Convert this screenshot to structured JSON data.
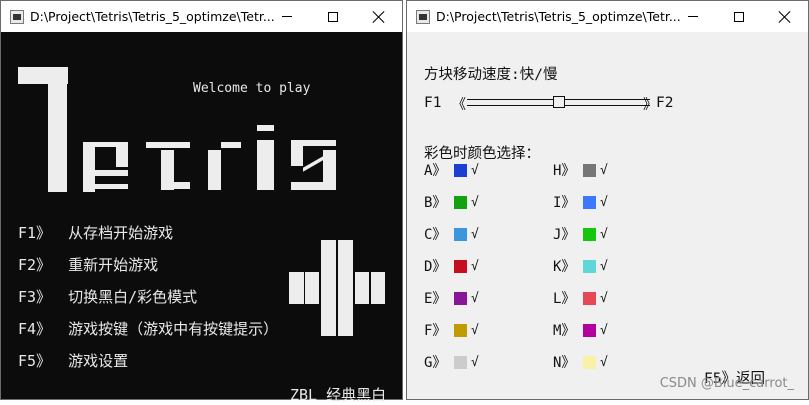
{
  "left_window": {
    "title": "D:\\Project\\Tetris\\Tetris_5_optimze\\Tetr...",
    "welcome": "Welcome to play",
    "menu": [
      {
        "key": "F1》",
        "text": "从存档开始游戏"
      },
      {
        "key": "F2》",
        "text": "重新开始游戏"
      },
      {
        "key": "F3》",
        "text": "切换黑白/彩色模式"
      },
      {
        "key": "F4》",
        "text": "游戏按键（游戏中有按键提示）"
      },
      {
        "key": "F5》",
        "text": "游戏设置"
      }
    ],
    "footer": "ZBL  经典黑白"
  },
  "right_window": {
    "title": "D:\\Project\\Tetris\\Tetris_5_optimze\\Tetr...",
    "speed_label": "方块移动速度:快/慢",
    "slider": {
      "left_label": "F1",
      "left_arrow": "《",
      "right_arrow": "》",
      "right_label": "F2",
      "position": 0.5
    },
    "color_label": "彩色时颜色选择：",
    "check_mark": "√",
    "colors_left": [
      {
        "label": "A》",
        "color": "#1a3fd1"
      },
      {
        "label": "B》",
        "color": "#13a10e"
      },
      {
        "label": "C》",
        "color": "#3a96dd"
      },
      {
        "label": "D》",
        "color": "#c50f1f"
      },
      {
        "label": "E》",
        "color": "#881798"
      },
      {
        "label": "F》",
        "color": "#c19c00"
      },
      {
        "label": "G》",
        "color": "#cccccc"
      }
    ],
    "colors_right": [
      {
        "label": "H》",
        "color": "#767676"
      },
      {
        "label": "I》",
        "color": "#3b78ff"
      },
      {
        "label": "J》",
        "color": "#16c60c"
      },
      {
        "label": "K》",
        "color": "#61d6d6"
      },
      {
        "label": "L》",
        "color": "#e74856"
      },
      {
        "label": "M》",
        "color": "#b4009e"
      },
      {
        "label": "N》",
        "color": "#f9f1a5"
      }
    ],
    "back_label": "F5》返回"
  },
  "watermark": "CSDN @Blue_carrot_"
}
